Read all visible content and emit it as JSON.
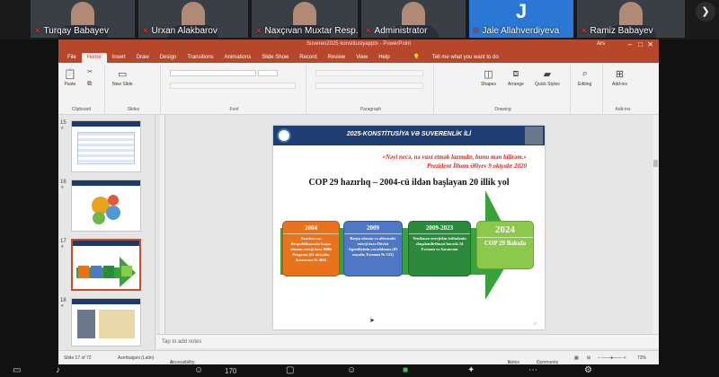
{
  "participants": [
    {
      "name": "Turqay Babayev"
    },
    {
      "name": "Urxan Alakbarov"
    },
    {
      "name": "Naxçıvan Muxtar Resp..."
    },
    {
      "name": "Administrator"
    },
    {
      "name": "Jale Allahverdiyeva",
      "initial": "J"
    },
    {
      "name": "Ramiz Babayev"
    }
  ],
  "powerpoint": {
    "title": "Suveren2025 konstitusiyapptx - PowerPoint",
    "user": "Ars",
    "tabs": [
      "File",
      "Home",
      "Insert",
      "Draw",
      "Design",
      "Transitions",
      "Animations",
      "Slide Show",
      "Record",
      "Review",
      "View",
      "Help"
    ],
    "active_tab": "Home",
    "tell_me": "Tell me what you want to do",
    "ribbon": {
      "paste": "Paste",
      "clipboard": "Clipboard",
      "new_slide": "New Slide",
      "slides": "Slides",
      "font": "Font",
      "paragraph": "Paragraph",
      "shapes": "Shapes",
      "arrange": "Arrange",
      "quick_styles": "Quick Styles",
      "drawing": "Drawing",
      "editing": "Editing",
      "add_ins": "Add-ins",
      "add_ins_group": "Add-ins"
    },
    "thumbnails": [
      {
        "num": "15"
      },
      {
        "num": "16"
      },
      {
        "num": "17"
      },
      {
        "num": "18"
      }
    ],
    "notes_placeholder": "Tap to add notes",
    "status": {
      "slide_count": "Slide 17 of 72",
      "language": "Azerbaijani (Latin)",
      "accessibility": "Accessibility: Investigate",
      "notes": "Notes",
      "comments": "Comments",
      "zoom": "73%"
    }
  },
  "slide": {
    "banner_title": "2025-KONSTİTUSİYA VƏ SUVERENLİK İLİ",
    "quote_line1": "«Nəyi necə, nə vaxt etmək lazımdır, bunu mən bilirəm.»",
    "quote_line2": "Prezident İlham Əliyev 9 oktyabr 2020",
    "heading": "COP 29 hazırlıq – 2004-cü ildən başlayan 20 illik yol",
    "steps": [
      {
        "year": "2004",
        "text": "Azərbaycan Respublikasında bərpa olunan enerji üzrə Milli Program (21 oktyabr, Sərəncam № 462)"
      },
      {
        "year": "2009",
        "text": "Bərpa olunan və alternativ enerji üzrə Dövlət Agentliyinin yaradılması (03 noyabr, Fərman № 123)"
      },
      {
        "year": "2009-2023",
        "text": "Yenilənən enerjidən istifadənin əlaqələndirilməsi barədə 14 Fərman və Sərəncam"
      },
      {
        "year": "2024",
        "text": "COP 29 Bakıda"
      }
    ],
    "page": "17"
  },
  "meeting": {
    "participant_count": "170"
  },
  "colors": {
    "ppt_accent": "#b7472a",
    "banner": "#1e3d72",
    "arrow": "#3aa23a",
    "step1": "#e8731c",
    "step2": "#4f78c4",
    "step3": "#2c8a3c",
    "step4": "#8cc84b"
  }
}
